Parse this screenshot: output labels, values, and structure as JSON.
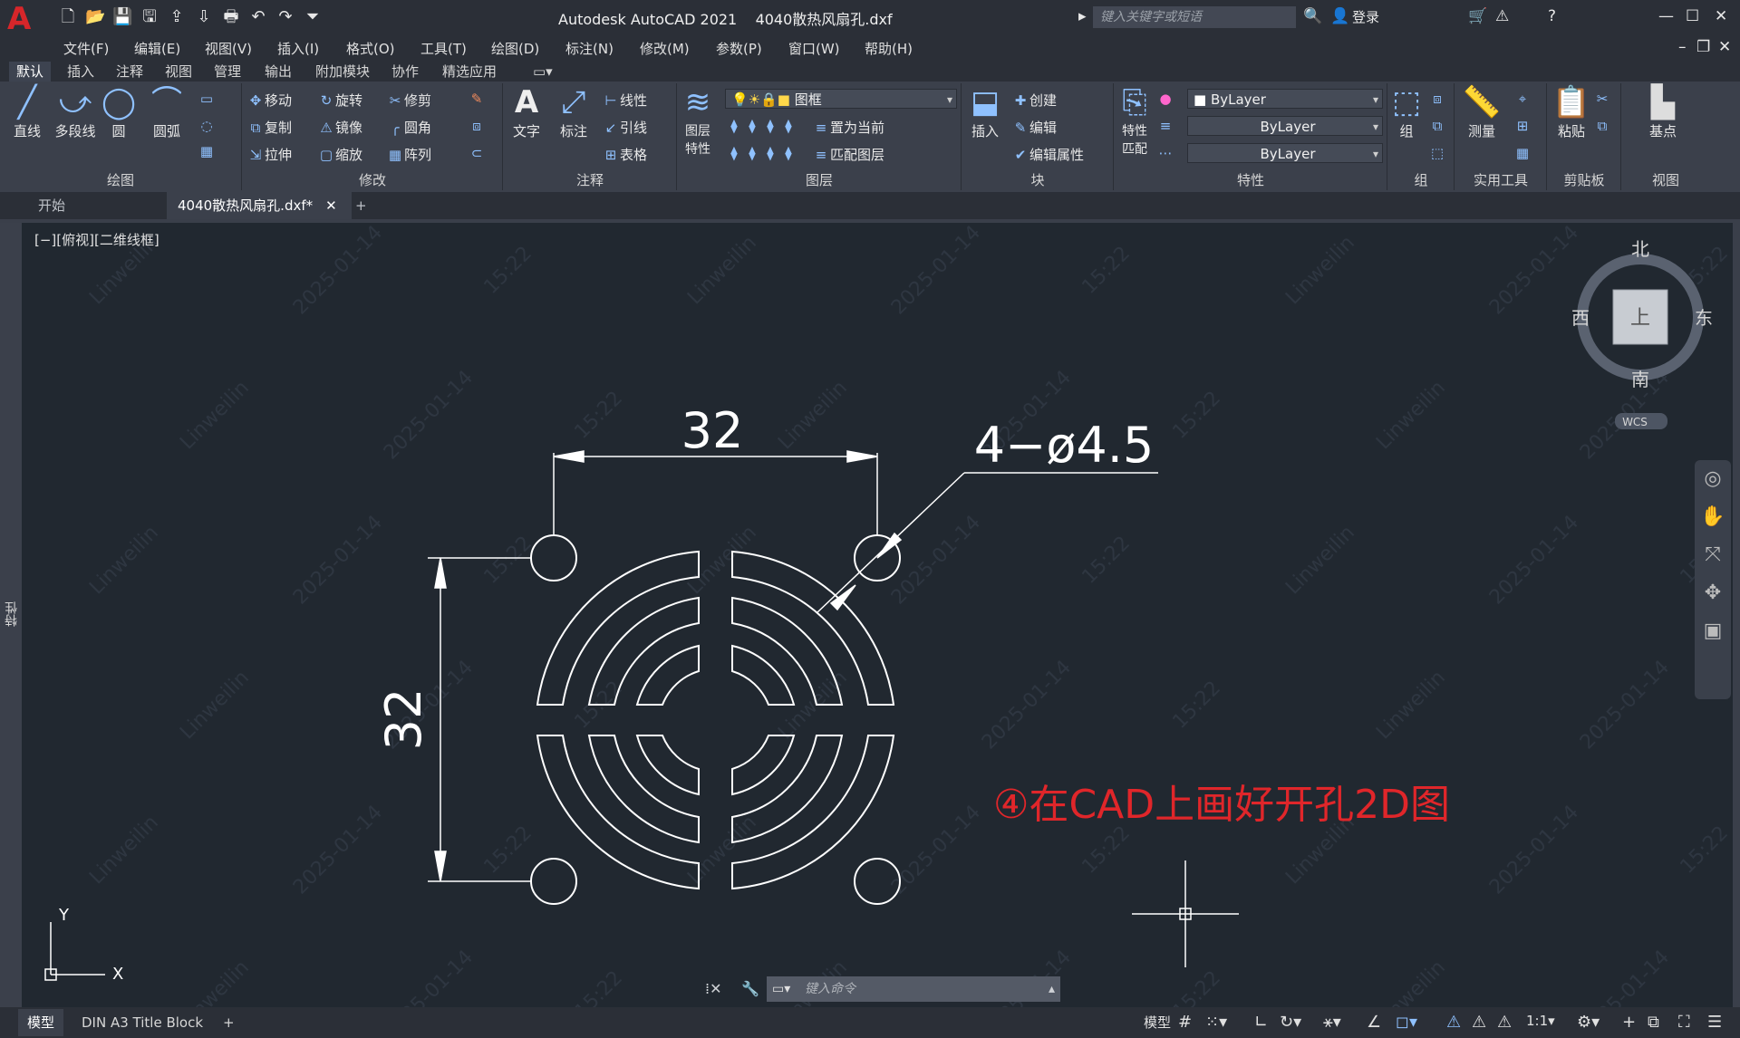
{
  "app": {
    "title": "Autodesk AutoCAD 2021    4040散热风扇孔.dxf",
    "search_placeholder": "键入关键字或短语",
    "login": "登录"
  },
  "menus": [
    "文件(F)",
    "编辑(E)",
    "视图(V)",
    "插入(I)",
    "格式(O)",
    "工具(T)",
    "绘图(D)",
    "标注(N)",
    "修改(M)",
    "参数(P)",
    "窗口(W)",
    "帮助(H)"
  ],
  "ribbon_tabs": [
    "默认",
    "插入",
    "注释",
    "视图",
    "管理",
    "输出",
    "附加模块",
    "协作",
    "精选应用"
  ],
  "ribbon": {
    "draw": {
      "title": "绘图",
      "line": "直线",
      "polyline": "多段线",
      "circle": "圆",
      "arc": "圆弧"
    },
    "modify": {
      "title": "修改",
      "move": "移动",
      "rotate": "旋转",
      "trim": "修剪",
      "copy": "复制",
      "mirror": "镜像",
      "fillet": "圆角",
      "stretch": "拉伸",
      "scale": "缩放",
      "array": "阵列"
    },
    "annotation": {
      "title": "注释",
      "text": "文字",
      "dim": "标注",
      "linear": "线性",
      "leader": "引线",
      "table": "表格"
    },
    "layers": {
      "title": "图层",
      "props": "图层特性",
      "current_layer": "图框",
      "set_current": "置为当前",
      "match_layer": "匹配图层"
    },
    "block": {
      "title": "块",
      "insert": "插入",
      "create": "创建",
      "edit": "编辑",
      "edit_attr": "编辑属性"
    },
    "properties": {
      "title": "特性",
      "match": "特性匹配",
      "color": "ByLayer",
      "linetype": "ByLayer",
      "lineweight": "ByLayer"
    },
    "groups": {
      "title": "组",
      "group": "组"
    },
    "utilities": {
      "title": "实用工具",
      "measure": "测量"
    },
    "clipboard": {
      "title": "剪贴板",
      "paste": "粘贴"
    },
    "view": {
      "title": "视图",
      "base": "基点"
    }
  },
  "doc_tabs": {
    "start": "开始",
    "file": "4040散热风扇孔.dxf*"
  },
  "canvas": {
    "view_label": "[−][俯视][二维线框]",
    "side_label": "特性",
    "viewcube": {
      "north": "北",
      "south": "南",
      "east": "东",
      "west": "西",
      "top": "上",
      "wcs": "WCS"
    },
    "dim_horizontal": "32",
    "dim_vertical": "32",
    "dim_holes": "4−ø4.5",
    "ucs_x": "X",
    "ucs_y": "Y",
    "annotation": "④在CAD上画好开孔2D图",
    "watermark_name": "Linweilin",
    "watermark_date": "2025-01-14",
    "watermark_time": "15:22"
  },
  "command_placeholder": "键入命令",
  "status_tabs": {
    "model": "模型",
    "layout": "DIN A3 Title Block"
  },
  "status_right": {
    "model": "模型",
    "scale": "1:1"
  },
  "colors": {
    "canvas": "#212830",
    "accent_red": "#e0262a",
    "line": "#ffffff"
  }
}
